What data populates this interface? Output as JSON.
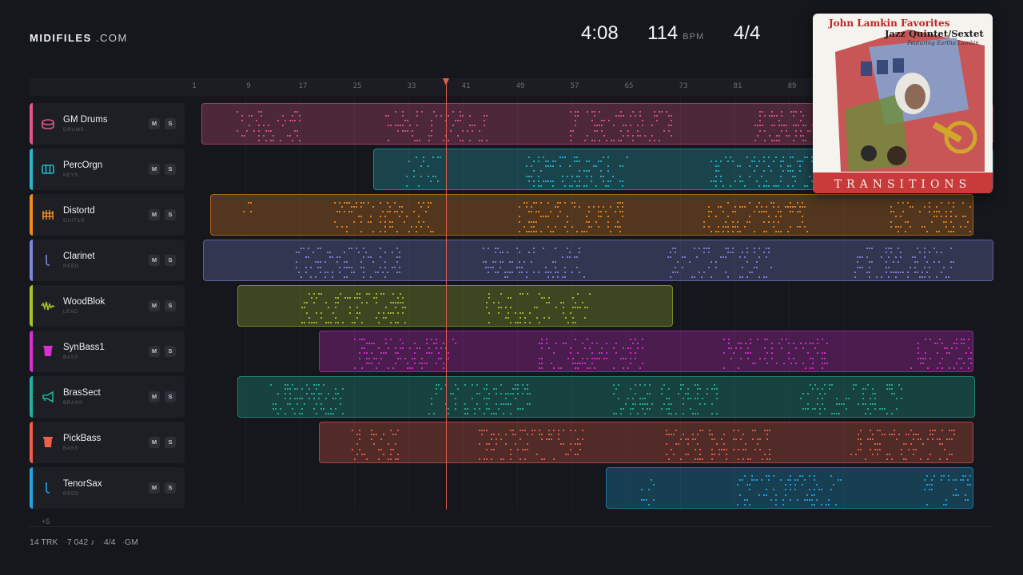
{
  "brand": {
    "name": "MIDIFILES",
    "suffix": " .COM"
  },
  "transport": {
    "time": "4:08",
    "tempo": "114",
    "tempo_unit": "BPM",
    "signature": "4/4"
  },
  "ruler": {
    "bars": [
      "1",
      "9",
      "17",
      "25",
      "33",
      "41",
      "49",
      "57",
      "65",
      "73",
      "81",
      "89"
    ]
  },
  "playhead": {
    "bar": 36
  },
  "tracks": [
    {
      "name": "GM Drums",
      "type": "DRUMS",
      "color": "#e0558a",
      "icon": "drum-icon",
      "mute": "M",
      "solo": "S"
    },
    {
      "name": "PercOrgn",
      "type": "KEYS",
      "color": "#2bb6c9",
      "icon": "piano-keys-icon",
      "mute": "M",
      "solo": "S"
    },
    {
      "name": "Distortd",
      "type": "GUITAR",
      "color": "#ef8a22",
      "icon": "guitar-grid-icon",
      "mute": "M",
      "solo": "S"
    },
    {
      "name": "Clarinet",
      "type": "REED",
      "color": "#8087d9",
      "icon": "reed-instrument-icon",
      "mute": "M",
      "solo": "S"
    },
    {
      "name": "WoodBlok",
      "type": "LEAD",
      "color": "#a5c32d",
      "icon": "waveform-icon",
      "mute": "M",
      "solo": "S"
    },
    {
      "name": "SynBass1",
      "type": "BASS",
      "color": "#d82fd2",
      "icon": "bass-block-icon",
      "mute": "M",
      "solo": "S"
    },
    {
      "name": "BrasSect",
      "type": "BRASS",
      "color": "#21b39a",
      "icon": "horn-icon",
      "mute": "M",
      "solo": "S"
    },
    {
      "name": "PickBass",
      "type": "BASS",
      "color": "#ee6048",
      "icon": "bass-block-icon",
      "mute": "M",
      "solo": "S"
    },
    {
      "name": "TenorSax",
      "type": "REED",
      "color": "#22a4dd",
      "icon": "reed-instrument-icon",
      "mute": "M",
      "solo": "S"
    }
  ],
  "more_tracks": "+5",
  "footer": {
    "tracks": "14 TRK",
    "notes": "7 042 ♪",
    "signature": "4/4",
    "standard": "GM"
  },
  "album": {
    "title": "John Lamkin Favorites",
    "subtitle": "Jazz Quintet/Sextet",
    "featuring": "Featuring Eartha Lamkin",
    "name": "TRANSITIONS"
  }
}
